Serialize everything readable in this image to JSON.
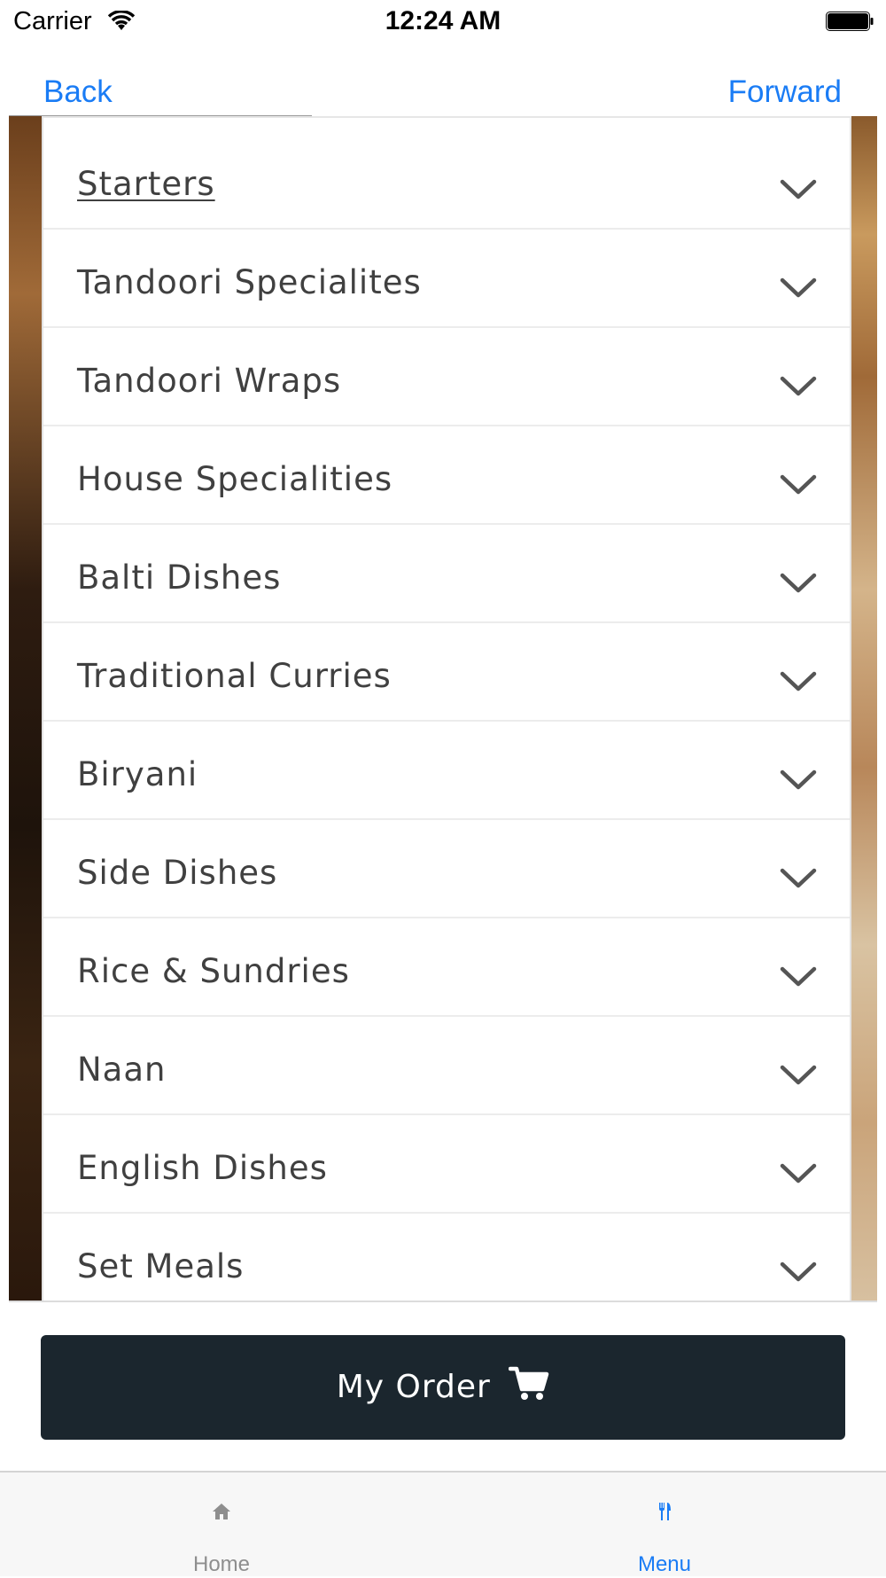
{
  "status_bar": {
    "carrier": "Carrier",
    "time": "12:24 AM"
  },
  "nav": {
    "back_label": "Back",
    "forward_label": "Forward"
  },
  "menu": {
    "items": [
      {
        "label": "Starters",
        "active": true
      },
      {
        "label": "Tandoori Specialites"
      },
      {
        "label": "Tandoori Wraps"
      },
      {
        "label": "House Specialities"
      },
      {
        "label": "Balti Dishes"
      },
      {
        "label": "Traditional Curries"
      },
      {
        "label": "Biryani"
      },
      {
        "label": "Side Dishes"
      },
      {
        "label": "Rice & Sundries"
      },
      {
        "label": "Naan"
      },
      {
        "label": "English Dishes"
      },
      {
        "label": "Set Meals"
      }
    ],
    "chevron_icon": "chevron-down-icon"
  },
  "order_button": {
    "label": "My Order",
    "icon": "cart-icon",
    "color": "#1b262e"
  },
  "tab_bar": {
    "tabs": [
      {
        "label": "Home",
        "icon": "home-icon",
        "selected": false
      },
      {
        "label": "Menu",
        "icon": "fork-knife-icon",
        "selected": true
      }
    ],
    "accent": "#1a7cf5"
  }
}
